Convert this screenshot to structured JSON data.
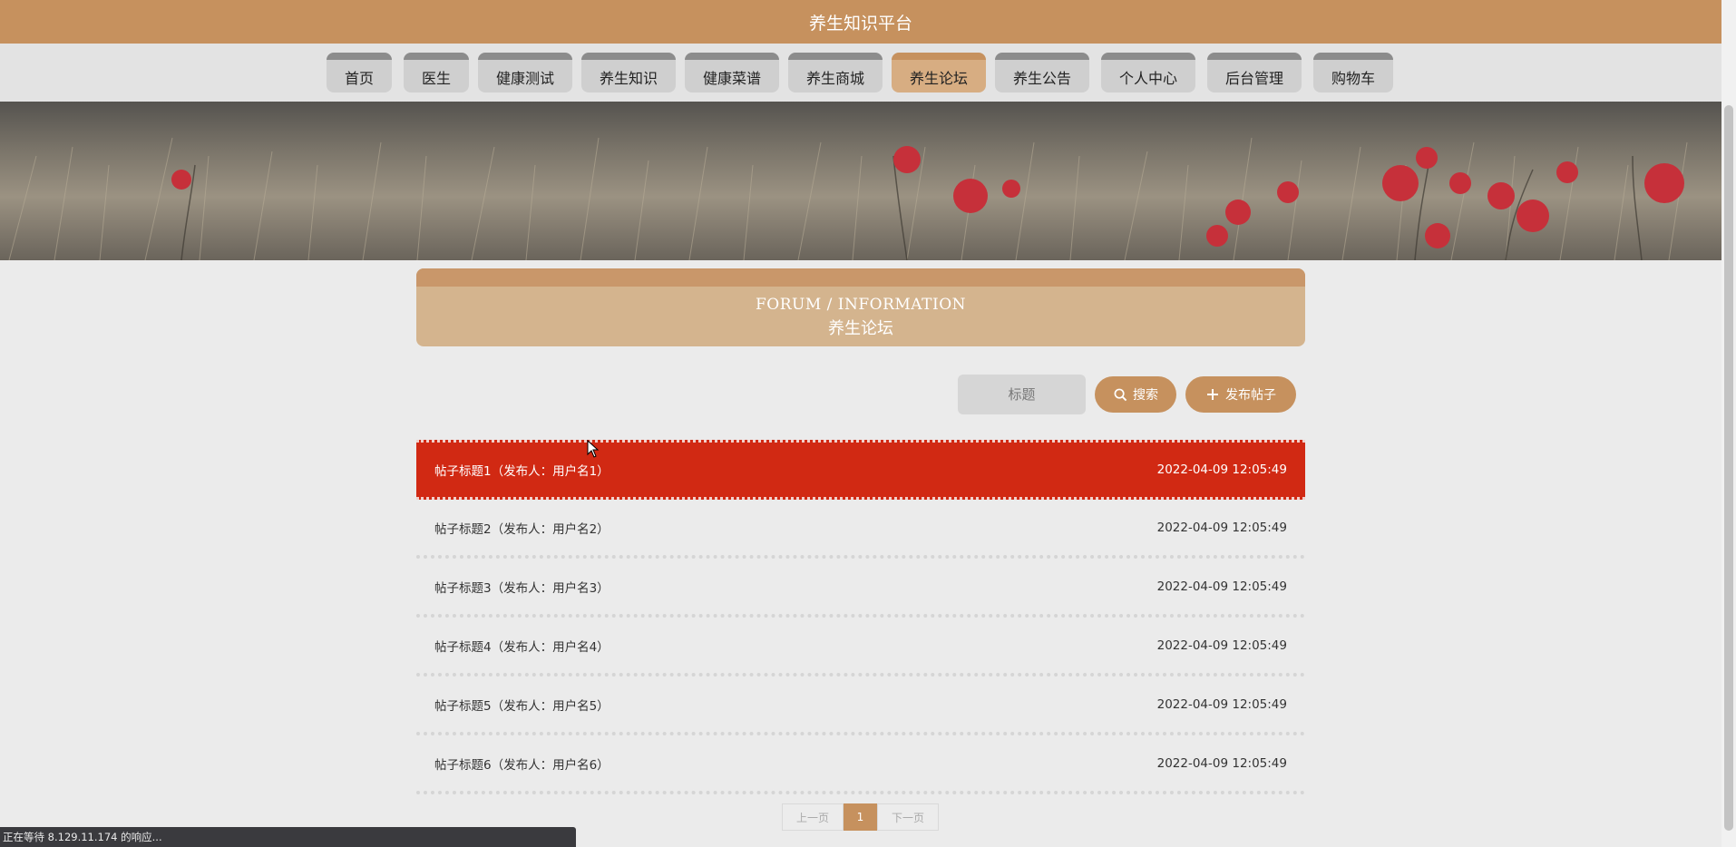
{
  "header": {
    "title": "养生知识平台"
  },
  "nav": {
    "items": [
      {
        "label": "首页"
      },
      {
        "label": "医生"
      },
      {
        "label": "健康测试"
      },
      {
        "label": "养生知识"
      },
      {
        "label": "健康菜谱"
      },
      {
        "label": "养生商城"
      },
      {
        "label": "养生论坛",
        "active": true
      },
      {
        "label": "养生公告"
      },
      {
        "label": "个人中心"
      },
      {
        "label": "后台管理"
      },
      {
        "label": "购物车"
      }
    ]
  },
  "section": {
    "title_en": "FORUM / INFORMATION",
    "title_cn": "养生论坛"
  },
  "search": {
    "placeholder": "标题",
    "button_label": "搜索",
    "publish_label": "发布帖子"
  },
  "posts": [
    {
      "title": "帖子标题1（发布人：用户名1）",
      "time": "2022-04-09 12:05:49"
    },
    {
      "title": "帖子标题2（发布人：用户名2）",
      "time": "2022-04-09 12:05:49"
    },
    {
      "title": "帖子标题3（发布人：用户名3）",
      "time": "2022-04-09 12:05:49"
    },
    {
      "title": "帖子标题4（发布人：用户名4）",
      "time": "2022-04-09 12:05:49"
    },
    {
      "title": "帖子标题5（发布人：用户名5）",
      "time": "2022-04-09 12:05:49"
    },
    {
      "title": "帖子标题6（发布人：用户名6）",
      "time": "2022-04-09 12:05:49"
    }
  ],
  "pagination": {
    "prev": "上一页",
    "current": "1",
    "next": "下一页"
  },
  "status": {
    "text": "正在等待 8.129.11.174 的响应..."
  },
  "colors": {
    "brand": "#c6915e",
    "highlight_row": "#d12913"
  }
}
